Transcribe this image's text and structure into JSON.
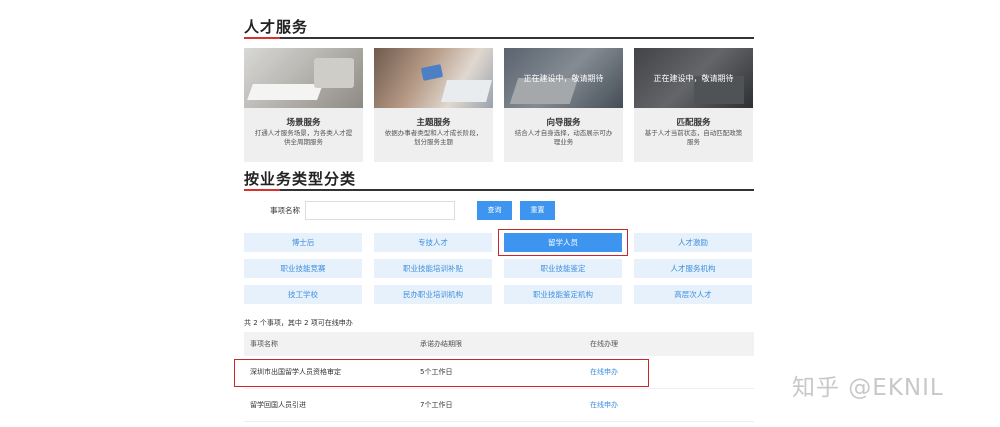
{
  "talent_section": {
    "title": "人才服务"
  },
  "cards": [
    {
      "title": "场景服务",
      "desc": "打通人才服务场景，为各类人才提供全周期服务",
      "overlay": ""
    },
    {
      "title": "主题服务",
      "desc": "依据办事者类型和人才成长阶段，划分服务主题",
      "overlay": ""
    },
    {
      "title": "向导服务",
      "desc": "结合人才自身选择，动态展示可办理业务",
      "overlay": "正在建设中，敬请期待"
    },
    {
      "title": "匹配服务",
      "desc": "基于人才当前状态，自动匹配政策服务",
      "overlay": "正在建设中，敬请期待"
    }
  ],
  "business_section": {
    "title": "按业务类型分类"
  },
  "search": {
    "label": "事项名称",
    "value": "",
    "placeholder": "",
    "query_button": "查询",
    "reset_button": "重置"
  },
  "categories": [
    "博士后",
    "专技人才",
    "留学人员",
    "人才激励",
    "职业技能竞赛",
    "职业技能培训补贴",
    "职业技能鉴定",
    "人才服务机构",
    "技工学校",
    "民办职业培训机构",
    "职业技能鉴定机构",
    "高层次人才"
  ],
  "active_category": "留学人员",
  "result_summary": "共 2 个事项，其中 2 项可在线申办",
  "table": {
    "headers": [
      "事项名称",
      "承诺办结期限",
      "在线办理"
    ],
    "rows": [
      [
        "深圳市出国留学人员资格审定",
        "5个工作日",
        "在线申办"
      ],
      [
        "留学回国人员引进",
        "7个工作日",
        "在线申办"
      ]
    ]
  },
  "watermark": "知乎 @EKNIL",
  "colors": {
    "accent": "#3d95f0",
    "tile_bg": "#e7f1fb",
    "highlight": "#c9262b",
    "title_accent": "#d7322c"
  }
}
